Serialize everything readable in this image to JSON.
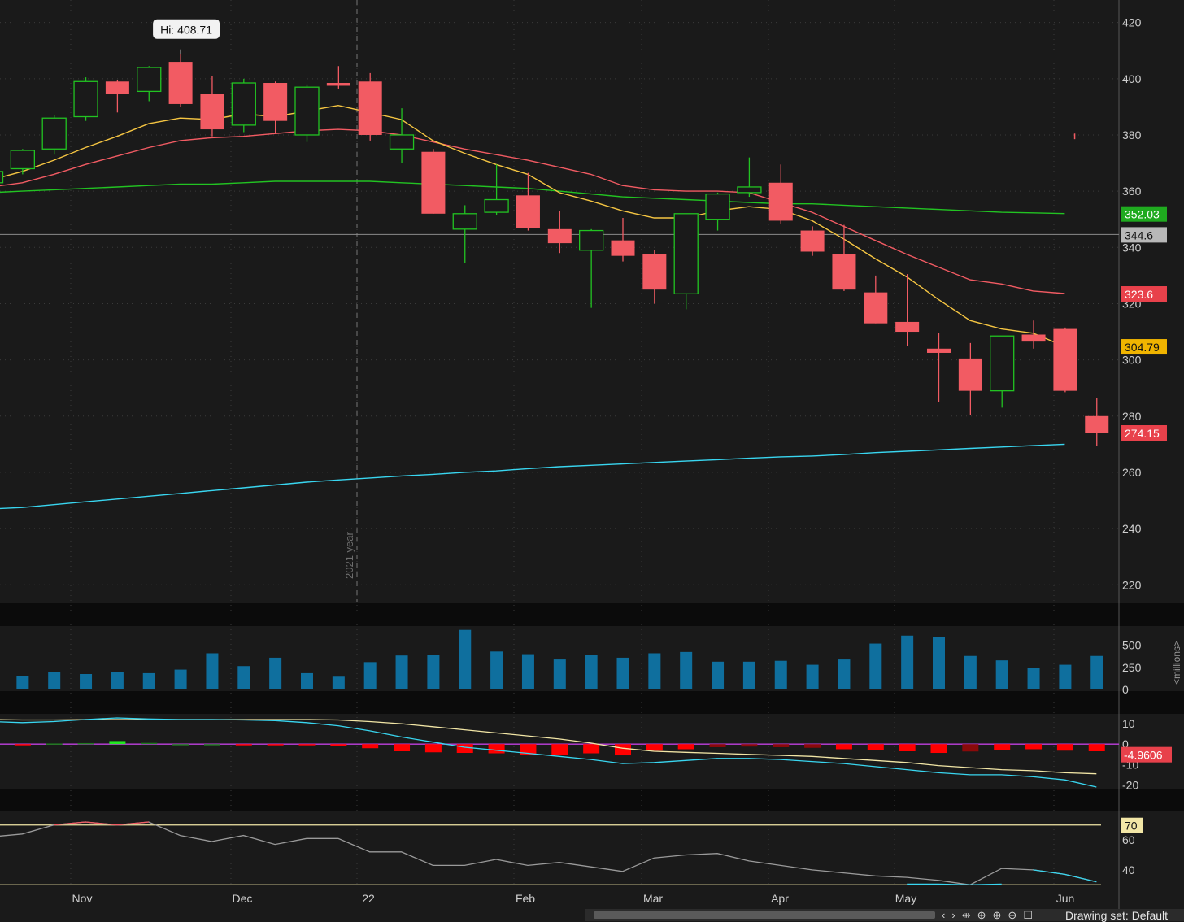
{
  "colors": {
    "background": "#1a1a1a",
    "up": "#22c322",
    "down": "#f25b63",
    "ema_fast": "#f5c542",
    "ema_mid": "#f25b63",
    "sma_long": "#22c322",
    "sma_200": "#39d6f0",
    "volume": "#0f6f9e",
    "macd_line": "#39d6f0",
    "macd_signal": "#f2e6a6",
    "macd_hist_neg": "#ff0000",
    "macd_hist_neg_dark": "#8a0a0a",
    "macd_zero": "#c040e0",
    "rsi_line": "#9a9a9a",
    "rsi_level": "#f2e6a6"
  },
  "chart_data": {
    "type": "candlestick",
    "price_axis": {
      "ticks": [
        "420",
        "400",
        "380",
        "360",
        "340",
        "320",
        "300",
        "280",
        "260",
        "240",
        "220"
      ],
      "range": [
        214,
        428
      ]
    },
    "x_axis": {
      "labels": [
        "Nov",
        "Dec",
        "22",
        "Feb",
        "Mar",
        "Apr",
        "May",
        "Jun"
      ]
    },
    "year_marker": "2021 year",
    "hi_label": "Hi: 408.71",
    "crosshair_label": "344.6",
    "price_labels": {
      "sma_long": "352.03",
      "ema_mid": "323.6",
      "ema_fast": "304.79",
      "last": "274.15"
    },
    "candles": [
      {
        "o": 363.0,
        "h": 366.0,
        "l": 356.0,
        "c": 367.0
      },
      {
        "o": 368.0,
        "h": 375.0,
        "l": 366.0,
        "c": 374.5
      },
      {
        "o": 375.0,
        "h": 387.0,
        "l": 373.0,
        "c": 386.0
      },
      {
        "o": 386.5,
        "h": 400.5,
        "l": 385.0,
        "c": 399.0
      },
      {
        "o": 399.0,
        "h": 399.5,
        "l": 388.0,
        "c": 394.5
      },
      {
        "o": 395.5,
        "h": 404.5,
        "l": 392.0,
        "c": 404.0
      },
      {
        "o": 406.0,
        "h": 408.7,
        "l": 390.0,
        "c": 391.0
      },
      {
        "o": 394.5,
        "h": 401.0,
        "l": 379.5,
        "c": 382.0
      },
      {
        "o": 383.5,
        "h": 400.0,
        "l": 381.0,
        "c": 398.5
      },
      {
        "o": 398.5,
        "h": 399.0,
        "l": 380.5,
        "c": 385.0
      },
      {
        "o": 380.0,
        "h": 398.0,
        "l": 377.5,
        "c": 397.0
      },
      {
        "o": 398.5,
        "h": 404.5,
        "l": 396.5,
        "c": 397.5
      },
      {
        "o": 399.0,
        "h": 402.0,
        "l": 378.0,
        "c": 380.0
      },
      {
        "o": 375.0,
        "h": 389.5,
        "l": 370.0,
        "c": 380.0
      },
      {
        "o": 374.0,
        "h": 375.0,
        "l": 353.0,
        "c": 352.0
      },
      {
        "o": 346.5,
        "h": 355.0,
        "l": 334.5,
        "c": 352.0
      },
      {
        "o": 352.5,
        "h": 369.5,
        "l": 351.5,
        "c": 357.0
      },
      {
        "o": 358.5,
        "h": 366.5,
        "l": 346.0,
        "c": 347.0
      },
      {
        "o": 346.5,
        "h": 353.0,
        "l": 338.0,
        "c": 341.5
      },
      {
        "o": 339.0,
        "h": 346.5,
        "l": 318.5,
        "c": 346.0
      },
      {
        "o": 342.5,
        "h": 350.5,
        "l": 335.0,
        "c": 337.0
      },
      {
        "o": 337.5,
        "h": 339.0,
        "l": 320.0,
        "c": 325.0
      },
      {
        "o": 323.5,
        "h": 352.0,
        "l": 318.0,
        "c": 352.0
      },
      {
        "o": 350.0,
        "h": 359.5,
        "l": 346.0,
        "c": 359.0
      },
      {
        "o": 359.5,
        "h": 372.0,
        "l": 358.0,
        "c": 361.5
      },
      {
        "o": 363.0,
        "h": 369.5,
        "l": 348.5,
        "c": 349.5
      },
      {
        "o": 346.0,
        "h": 347.5,
        "l": 337.0,
        "c": 338.5
      },
      {
        "o": 337.5,
        "h": 348.0,
        "l": 324.5,
        "c": 325.0
      },
      {
        "o": 324.0,
        "h": 330.0,
        "l": 313.0,
        "c": 313.0
      },
      {
        "o": 313.5,
        "h": 330.5,
        "l": 305.0,
        "c": 310.0
      },
      {
        "o": 304.0,
        "h": 309.5,
        "l": 285.0,
        "c": 302.5
      },
      {
        "o": 300.5,
        "h": 306.0,
        "l": 280.5,
        "c": 289.0
      },
      {
        "o": 289.0,
        "h": 308.5,
        "l": 283.0,
        "c": 308.5
      },
      {
        "o": 309.0,
        "h": 314.0,
        "l": 304.0,
        "c": 306.5
      },
      {
        "o": 311.0,
        "h": 311.5,
        "l": 288.5,
        "c": 289.0
      },
      {
        "o": 280.0,
        "h": 286.5,
        "l": 269.5,
        "c": 274.15
      }
    ],
    "extra_marks": [
      {
        "candle_index": 34.3,
        "low": 378.5,
        "high": 380.5
      }
    ],
    "ema_fast": [
      364,
      367,
      371,
      375.5,
      379.5,
      384,
      386,
      385.5,
      387.5,
      386.5,
      388.5,
      390.5,
      388,
      385.5,
      378,
      373.5,
      369.5,
      366,
      359.5,
      356.5,
      353,
      350.5,
      350.5,
      353,
      354.5,
      353.5,
      349.5,
      343,
      336,
      329.5,
      321.5,
      314,
      311,
      309.5,
      304.79
    ],
    "ema_mid": [
      361.5,
      363,
      366,
      369.5,
      372.5,
      375.5,
      378,
      379,
      379.5,
      380.5,
      381.5,
      382,
      381.5,
      380,
      377.5,
      375,
      373,
      371,
      368.5,
      366,
      362,
      360.5,
      360,
      360,
      359.5,
      356,
      352.5,
      347.5,
      342.5,
      337.5,
      333,
      328.5,
      327,
      324.5,
      323.6
    ],
    "sma_long": [
      359.5,
      360,
      360.5,
      361,
      361.5,
      362,
      362.5,
      362.5,
      363,
      363.5,
      363.5,
      363.5,
      363.5,
      363,
      362.5,
      362,
      361.5,
      361,
      360,
      359,
      358,
      357.5,
      357,
      356.5,
      356,
      355.5,
      355.5,
      355,
      354.5,
      354,
      353.5,
      353,
      352.5,
      352.3,
      352.03
    ],
    "sma_200": [
      247,
      247.5,
      248.5,
      249.5,
      250.5,
      251.5,
      252.5,
      253.5,
      254.5,
      255.5,
      256.5,
      257.3,
      258,
      258.7,
      259.3,
      260,
      260.5,
      261.3,
      262,
      262.5,
      263,
      263.5,
      264,
      264.5,
      265,
      265.5,
      265.8,
      266.3,
      267,
      267.5,
      268,
      268.5,
      269,
      269.5,
      270
    ],
    "volume": {
      "unit": "<millions>",
      "ticks": [
        "500",
        "250",
        "0"
      ],
      "range": [
        0,
        700
      ],
      "values": [
        150,
        200,
        175,
        200,
        185,
        225,
        410,
        265,
        360,
        185,
        145,
        310,
        385,
        395,
        675,
        430,
        400,
        340,
        390,
        360,
        410,
        425,
        315,
        315,
        325,
        280,
        340,
        520,
        610,
        590,
        380,
        330,
        240,
        280,
        380
      ]
    },
    "macd": {
      "ticks": [
        "10",
        "0",
        "-10",
        "-20"
      ],
      "range": [
        -21,
        14
      ],
      "value_label": "-4.9606",
      "line": [
        11,
        10.5,
        11,
        12,
        12.8,
        12.3,
        12,
        12,
        11.8,
        11.5,
        10.5,
        9,
        6.5,
        3.5,
        1,
        -1.5,
        -3,
        -4.5,
        -6,
        -7.5,
        -9.5,
        -9,
        -8,
        -7,
        -7,
        -7.5,
        -8.5,
        -9.5,
        -11,
        -12.5,
        -14,
        -15,
        -15,
        -16,
        -17.5,
        -21
      ],
      "signal": [
        12,
        11.8,
        11.8,
        12,
        12,
        12,
        12,
        12,
        12,
        12,
        12,
        11.8,
        11,
        10,
        8.5,
        7,
        5.5,
        4,
        2.5,
        0.5,
        -2,
        -3.5,
        -4,
        -4.5,
        -5,
        -5.5,
        -6,
        -7,
        -8,
        -9,
        -10.5,
        -11.5,
        -12.5,
        -13,
        -14,
        -14.5
      ],
      "hist": [
        -1.2,
        -0.5,
        0.3,
        0.5,
        1.5,
        0.6,
        0,
        0,
        -0.4,
        -0.4,
        -0.4,
        -1,
        -2,
        -3.5,
        -4,
        -4.3,
        -4.5,
        -5.5,
        -5.5,
        -4.5,
        -5.5,
        -3.2,
        -2.5,
        -1.5,
        -1.2,
        -1.5,
        -1.8,
        -2.5,
        -3,
        -3.5,
        -4.3,
        -3.6,
        -3,
        -2.5,
        -3.2,
        -3.5
      ]
    },
    "rsi": {
      "ticks": [
        "60",
        "40"
      ],
      "range": [
        28,
        78
      ],
      "level_label": "70",
      "levels": [
        70,
        30
      ],
      "values": [
        62,
        64,
        70,
        72,
        70,
        72,
        63,
        59,
        63,
        57,
        61,
        61,
        52,
        52,
        43,
        43,
        47,
        43,
        45,
        42,
        39,
        48,
        50,
        51,
        46,
        43,
        40,
        38,
        36,
        35,
        33,
        30,
        41,
        40,
        37,
        32
      ]
    }
  },
  "toolbar": {
    "scroll_grip": "III",
    "left_arrow": "‹",
    "right_arrow": "›",
    "icons": [
      "chart-style-icon",
      "crosshair-icon",
      "zoom-in-icon",
      "zoom-out-icon",
      "drawing-icon"
    ],
    "drawing_set": "Drawing set: Default"
  }
}
